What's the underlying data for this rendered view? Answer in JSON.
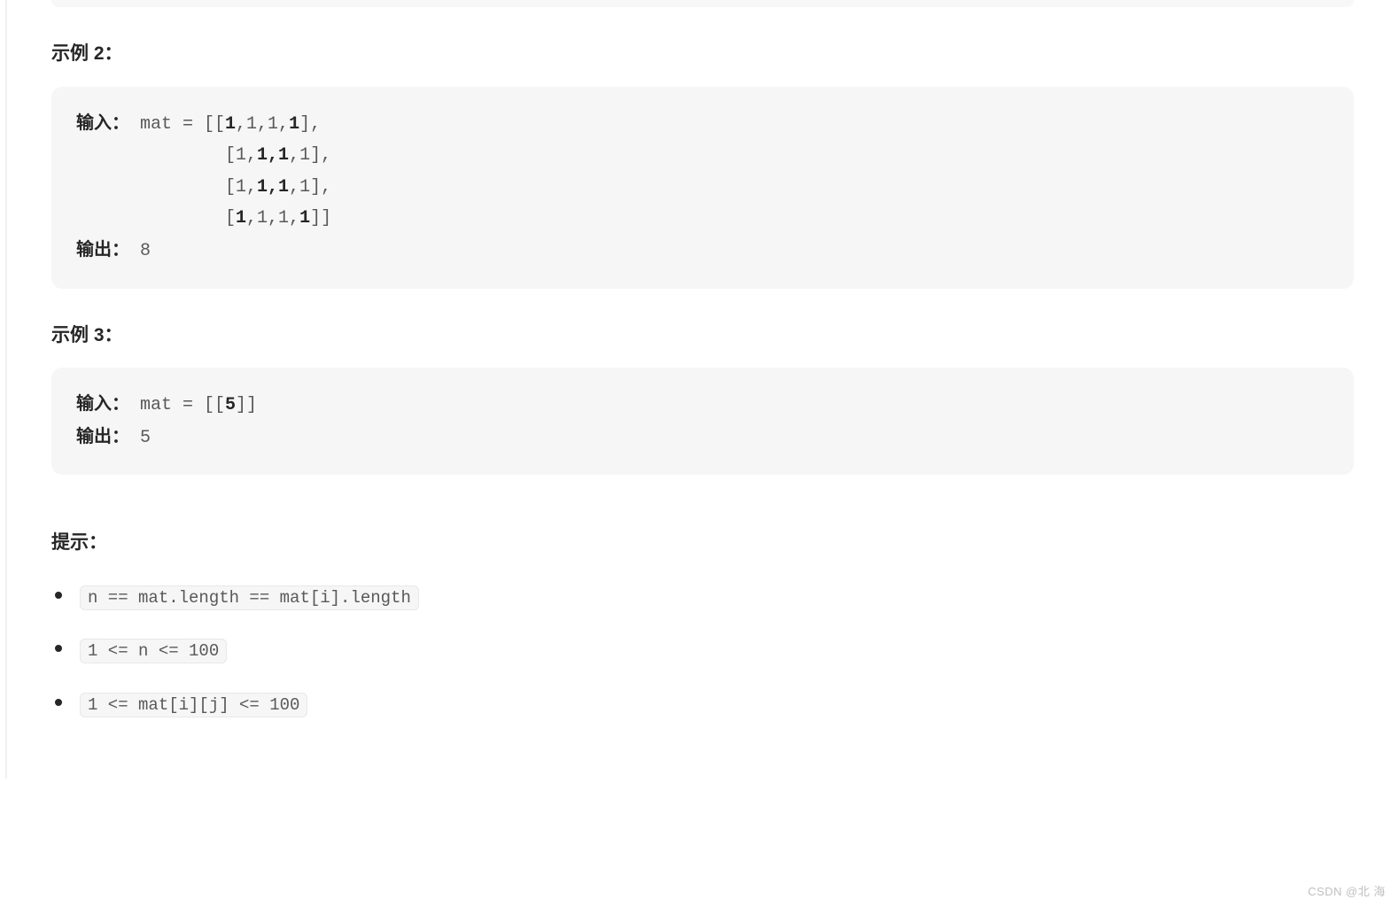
{
  "example2": {
    "heading": "示例  2：",
    "input_label": "输入：",
    "input_prefix": "mat = [[",
    "row1": [
      "1",
      ",1,1,",
      "1",
      "],"
    ],
    "row2_pad": "              [1,",
    "row2_bold": "1,1",
    "row2_suffix": ",1],",
    "row3_pad": "              [1,",
    "row3_bold": "1,1",
    "row3_suffix": ",1],",
    "row4_pad": "              [",
    "row4_b1": "1",
    "row4_mid": ",1,1,",
    "row4_b2": "1",
    "row4_end": "]]",
    "output_label": "输出：",
    "output_value": "8"
  },
  "example3": {
    "heading": "示例 3：",
    "input_label": "输入：",
    "input_text": "mat = [[",
    "input_bold": "5",
    "input_end": "]]",
    "output_label": "输出：",
    "output_value": "5"
  },
  "hints": {
    "heading": "提示：",
    "items": [
      "n == mat.length == mat[i].length",
      "1 <= n <= 100",
      "1 <= mat[i][j] <= 100"
    ]
  },
  "watermark": "CSDN @北 海"
}
